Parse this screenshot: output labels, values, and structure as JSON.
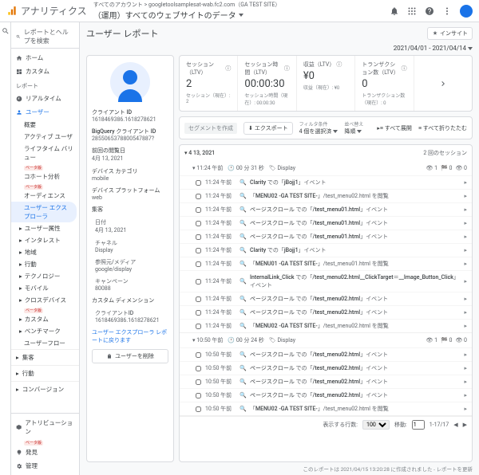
{
  "header": {
    "brand": "アナリティクス",
    "account_line": "すべてのアカウント > googletoolsamplesat-wab.fc2.com（GA TEST SITE）",
    "property": "（運用）すべてのウェブサイトのデータ"
  },
  "search_placeholder": "レポートとヘルプを検索",
  "nav": {
    "home": "ホーム",
    "custom": "カスタム",
    "section_reports": "レポート",
    "realtime": "リアルタイム",
    "user": "ユーザー",
    "user_items": {
      "overview": "概要",
      "active": "アクティブ ユーザ",
      "ltv": "ライフタイム バリュー",
      "cohort": "コホート分析",
      "audience": "オーディエンス",
      "explorer": "ユーザー エクスプローラ",
      "attr": "ユーザー属性",
      "interest": "インタレスト",
      "geo": "地域",
      "behavior": "行動",
      "tech": "テクノロジー",
      "mobile": "モバイル",
      "cross": "クロスデバイス",
      "cust": "カスタム",
      "bench": "ベンチマーク",
      "flow": "ユーザーフロー"
    },
    "acquisition": "集客",
    "behavior_g": "行動",
    "conversion": "コンバージョン",
    "attribution": "アトリビューション",
    "discover": "発見",
    "admin": "管理",
    "beta": "ベータ版"
  },
  "page": {
    "title": "ユーザー レポート",
    "insight": "インサイト",
    "date_range": "2021/04/01 - 2021/04/14"
  },
  "metrics": [
    {
      "label": "セッション（LTV）",
      "value": "2",
      "sub": "セッション（現在）: 2"
    },
    {
      "label": "セッション時間（LTV）",
      "value": "00:00:30",
      "sub": "セッション時間（現在）: 00:00:30"
    },
    {
      "label": "収益（LTV）",
      "value": "¥0",
      "sub": "収益（現在）: ¥0"
    },
    {
      "label": "トランザクション数（LTV）",
      "value": "0",
      "sub": "トランザクション数（現在）: 0"
    }
  ],
  "profile": {
    "fields": [
      {
        "l": "クライアント ID",
        "v": "1618469386.1618278621"
      },
      {
        "l": "BigQuery クライアント ID",
        "v": "2855065378800547887?"
      },
      {
        "l": "前回の閲覧日",
        "v": "4月 13, 2021"
      },
      {
        "l": "デバイス カテゴリ",
        "v": "mobile"
      },
      {
        "l": "デバイス プラットフォーム",
        "v": "web"
      },
      {
        "l": "集客",
        "sub": [
          {
            "l": "日付",
            "v": "4月 13, 2021"
          },
          {
            "l": "チャネル",
            "v": "Display"
          },
          {
            "l": "参照元/メディア",
            "v": "google/display"
          },
          {
            "l": "キャンペーン",
            "v": "80088"
          }
        ]
      },
      {
        "l": "カスタム ディメンション",
        "sub": [
          {
            "l": "クライアントID",
            "v": "1618469386.1618278621"
          }
        ]
      }
    ],
    "explorer_link": "ユーザー エクスプローラ レポートに戻ります",
    "delete_btn": "ユーザーを削除"
  },
  "filterbar": {
    "segment": "セグメントを作成",
    "export": "エクスポート",
    "filter_label": "フィルタ条件",
    "filter_value": "4 個を選択済",
    "sort_label": "並べ替え",
    "sort_value": "降順",
    "expand_all": "すべて展開",
    "collapse_all": "すべて折りたたむ"
  },
  "timeline": {
    "sessions": [
      {
        "date": "4 13, 2021",
        "count": "2 回のセッション",
        "sub": {
          "time": "11:24 午前",
          "dur": "00 分 31 秒",
          "channel": "Display",
          "c1": "1",
          "c2": "0",
          "c3": "0"
        },
        "rows": [
          {
            "t": "11:24 午前",
            "i": "q",
            "txt": "<b>Clarity</b> での「<b>jBojj1</b>」イベント",
            "exp": 1
          },
          {
            "t": "11:24 午前",
            "i": "q",
            "txt": "「<b>MENU02 -GA TEST SITE-</b>」<span class='g'>/test_menu02.html</span> を閲覧",
            "exp": 1
          },
          {
            "t": "11:24 午前",
            "i": "q",
            "txt": "<b>ページスクロール</b> での「<b>/test_menu01.html</b>」イベント",
            "exp": 1
          },
          {
            "t": "11:24 午前",
            "i": "q",
            "txt": "<b>ページスクロール</b> での「<b>/test_menu01.html</b>」イベント",
            "exp": 1
          },
          {
            "t": "11:24 午前",
            "i": "q",
            "txt": "<b>ページスクロール</b> での「<b>/test_menu01.html</b>」イベント",
            "exp": 1
          },
          {
            "t": "11:24 午前",
            "i": "q",
            "txt": "<b>Clarity</b> での「<b>jBojj1</b>」イベント",
            "exp": 1
          },
          {
            "t": "11:24 午前",
            "i": "q",
            "txt": "「<b>MENU01 -GA TEST SITE-</b>」<span class='g'>/test_menu01.html</span> を閲覧",
            "exp": 1
          },
          {
            "t": "11:24 午前",
            "i": "q",
            "txt": "<b>InternalLink_Click</b> での「<b>/test_menu02.html__ClickTarget＝__Image_Button_Click</b>」イベント",
            "exp": 1
          },
          {
            "t": "11:24 午前",
            "i": "q",
            "txt": "<b>ページスクロール</b> での「<b>/test_menu02.html</b>」イベント",
            "exp": 1
          },
          {
            "t": "11:24 午前",
            "i": "q",
            "txt": "<b>ページスクロール</b> での「<b>/test_menu02.html</b>」イベント",
            "exp": 1
          },
          {
            "t": "11:24 午前",
            "i": "q",
            "txt": "「<b>MENU02 -GA TEST SITE-</b>」<span class='g'>/test_menu02.html</span> を閲覧",
            "exp": 1
          }
        ]
      },
      {
        "sub": {
          "time": "10:50 午前",
          "dur": "00 分 24 秒",
          "channel": "Display",
          "c1": "1",
          "c2": "0",
          "c3": "0"
        },
        "rows": [
          {
            "t": "10:50 午前",
            "i": "q",
            "txt": "<b>ページスクロール</b> での「<b>/test_menu02.html</b>」イベント",
            "exp": 1
          },
          {
            "t": "10:50 午前",
            "i": "q",
            "txt": "<b>ページスクロール</b> での「<b>/test_menu02.html</b>」イベント",
            "exp": 1
          },
          {
            "t": "10:50 午前",
            "i": "q",
            "txt": "<b>ページスクロール</b> での「<b>/test_menu02.html</b>」イベント",
            "exp": 1
          },
          {
            "t": "10:50 午前",
            "i": "q",
            "txt": "<b>ページスクロール</b> での「<b>/test_menu02.html</b>」イベント",
            "exp": 1
          },
          {
            "t": "10:50 午前",
            "i": "q",
            "txt": "「<b>MENU02 -GA TEST SITE-</b>」<span class='g'>/test_menu02.html</span> を閲覧",
            "exp": 1
          }
        ]
      }
    ],
    "footer": {
      "show": "表示する行数:",
      "per": "100",
      "goto": "移動:",
      "gval": "1",
      "range": "1-17/17"
    }
  },
  "timestamp": "このレポートは 2021/04/15 13:20:28 に作成されました - レポートを更新"
}
